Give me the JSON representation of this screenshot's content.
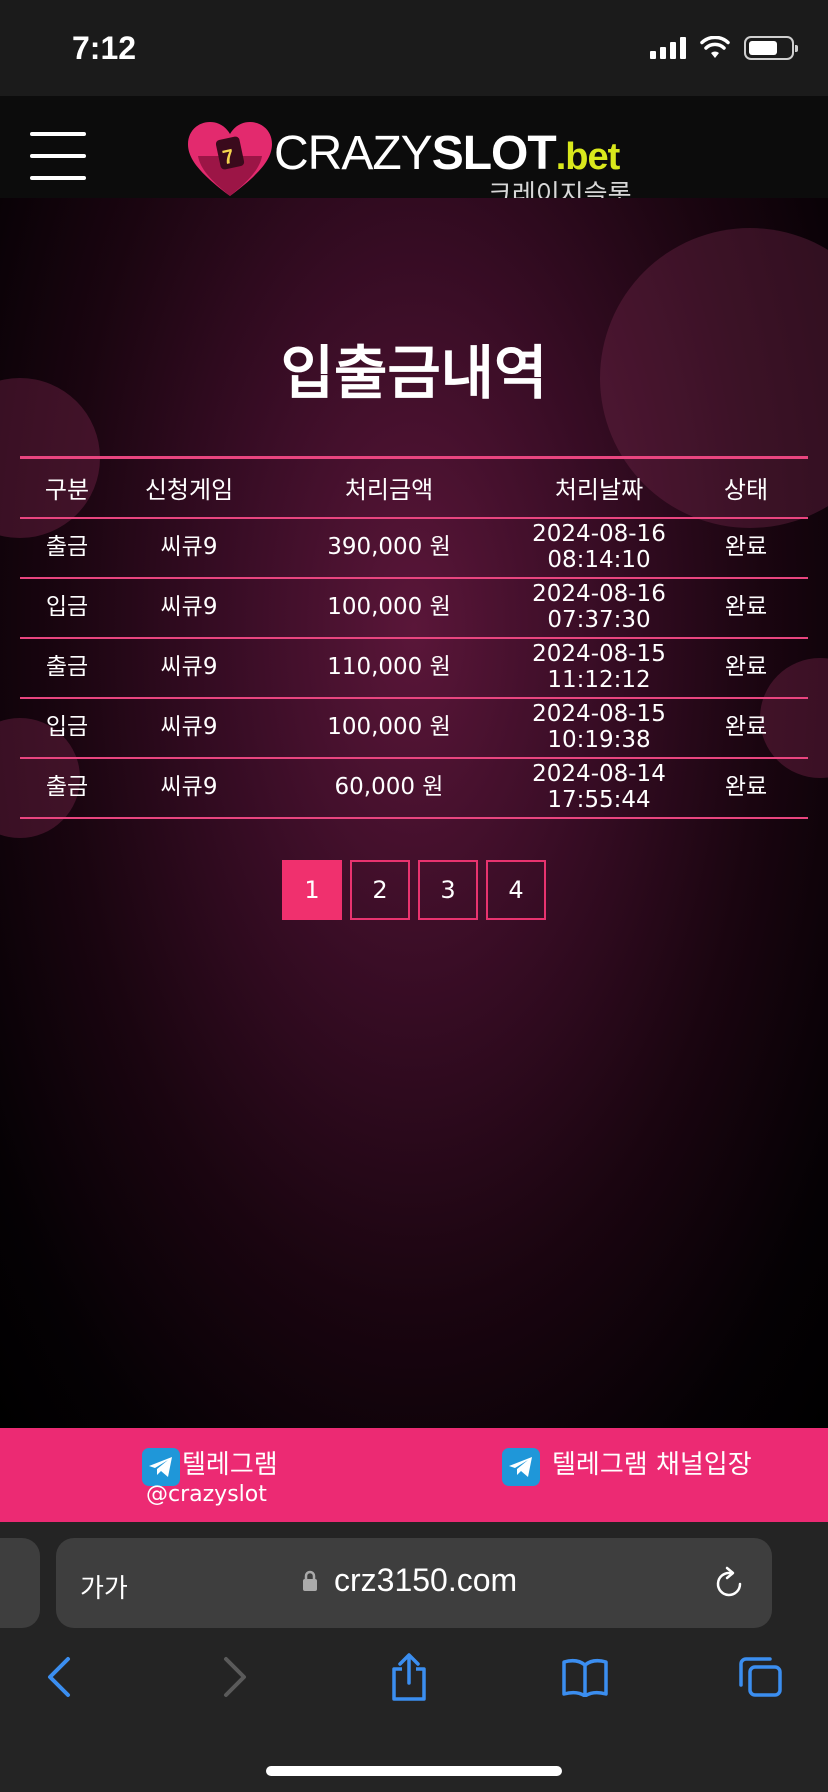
{
  "status_bar": {
    "time": "7:12"
  },
  "header": {
    "logo_crazy": "CRAZY",
    "logo_slot": "SLOT",
    "logo_bet": ".bet",
    "logo_sub": "크레이지슬롯"
  },
  "page": {
    "title": "입출금내역"
  },
  "table": {
    "headers": [
      "구분",
      "신청게임",
      "처리금액",
      "처리날짜",
      "상태"
    ],
    "rows": [
      {
        "type": "출금",
        "game": "씨큐9",
        "amount": "390,000 원",
        "date": "2024-08-16",
        "time": "08:14:10",
        "status": "완료"
      },
      {
        "type": "입금",
        "game": "씨큐9",
        "amount": "100,000 원",
        "date": "2024-08-16",
        "time": "07:37:30",
        "status": "완료"
      },
      {
        "type": "출금",
        "game": "씨큐9",
        "amount": "110,000 원",
        "date": "2024-08-15",
        "time": "11:12:12",
        "status": "완료"
      },
      {
        "type": "입금",
        "game": "씨큐9",
        "amount": "100,000 원",
        "date": "2024-08-15",
        "time": "10:19:38",
        "status": "완료"
      },
      {
        "type": "출금",
        "game": "씨큐9",
        "amount": "60,000 원",
        "date": "2024-08-14",
        "time": "17:55:44",
        "status": "완료"
      }
    ]
  },
  "pagination": {
    "pages": [
      "1",
      "2",
      "3",
      "4"
    ],
    "active_page": "1"
  },
  "footer": {
    "telegram_label": "텔레그램",
    "telegram_handle": "@crazyslot",
    "telegram_channel_label": "텔레그램 채널입장"
  },
  "browser": {
    "text_size_label": "가가",
    "url": "crz3150.com"
  },
  "colors": {
    "accent": "#ec2a73",
    "border": "#e8457f",
    "logo_bet": "#d9e81c"
  }
}
